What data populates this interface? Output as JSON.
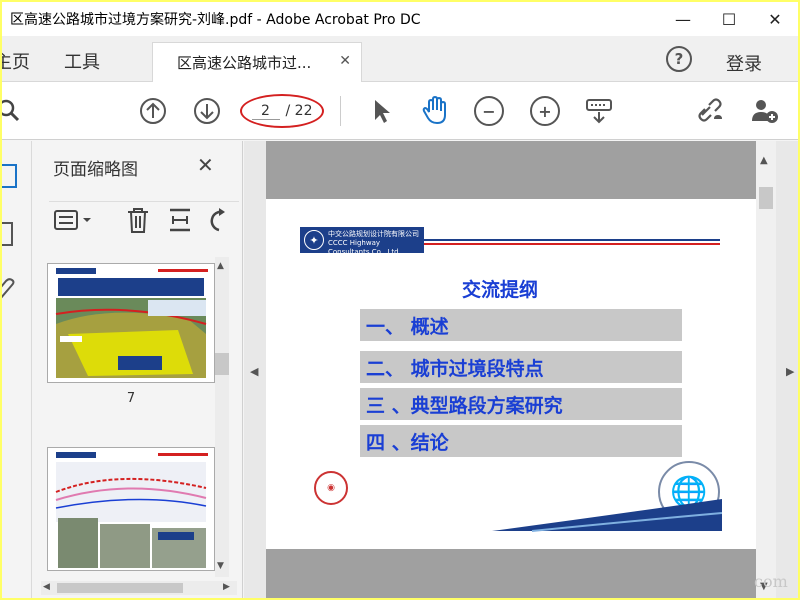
{
  "window": {
    "title": "区高速公路城市过境方案研究-刘峰.pdf - Adobe Acrobat Pro DC",
    "minimize_glyph": "—",
    "maximize_glyph": "☐",
    "close_glyph": "✕"
  },
  "tabs": {
    "home_label": "主页",
    "tools_label": "工具",
    "document_tab_label": "区高速公路城市过...",
    "document_tab_close": "✕",
    "help_glyph": "?",
    "login_label": "登录"
  },
  "toolbar": {
    "current_page": "2",
    "page_total": "/ 22"
  },
  "thumbnails": {
    "title": "页面缩略图",
    "close_glyph": "✕",
    "pages": [
      {
        "label": "7"
      },
      {
        "label": ""
      }
    ]
  },
  "slide": {
    "logo_text_cn": "中交公路规划设计院有限公司",
    "logo_text_en": "CCCC Highway Consultants Co., Ltd.",
    "title": "交流提纲",
    "outline": [
      "一、 概述",
      "二、 城市过境段特点",
      "三 、典型路段方案研究",
      "四 、结论"
    ]
  },
  "watermark": "com",
  "colors": {
    "accent_blue": "#1a3fd4",
    "brand_navy": "#1c3f8a",
    "annotation_red": "#d42020",
    "outline_bg": "#c8c8c8",
    "icon_blue": "#1a73c7"
  }
}
